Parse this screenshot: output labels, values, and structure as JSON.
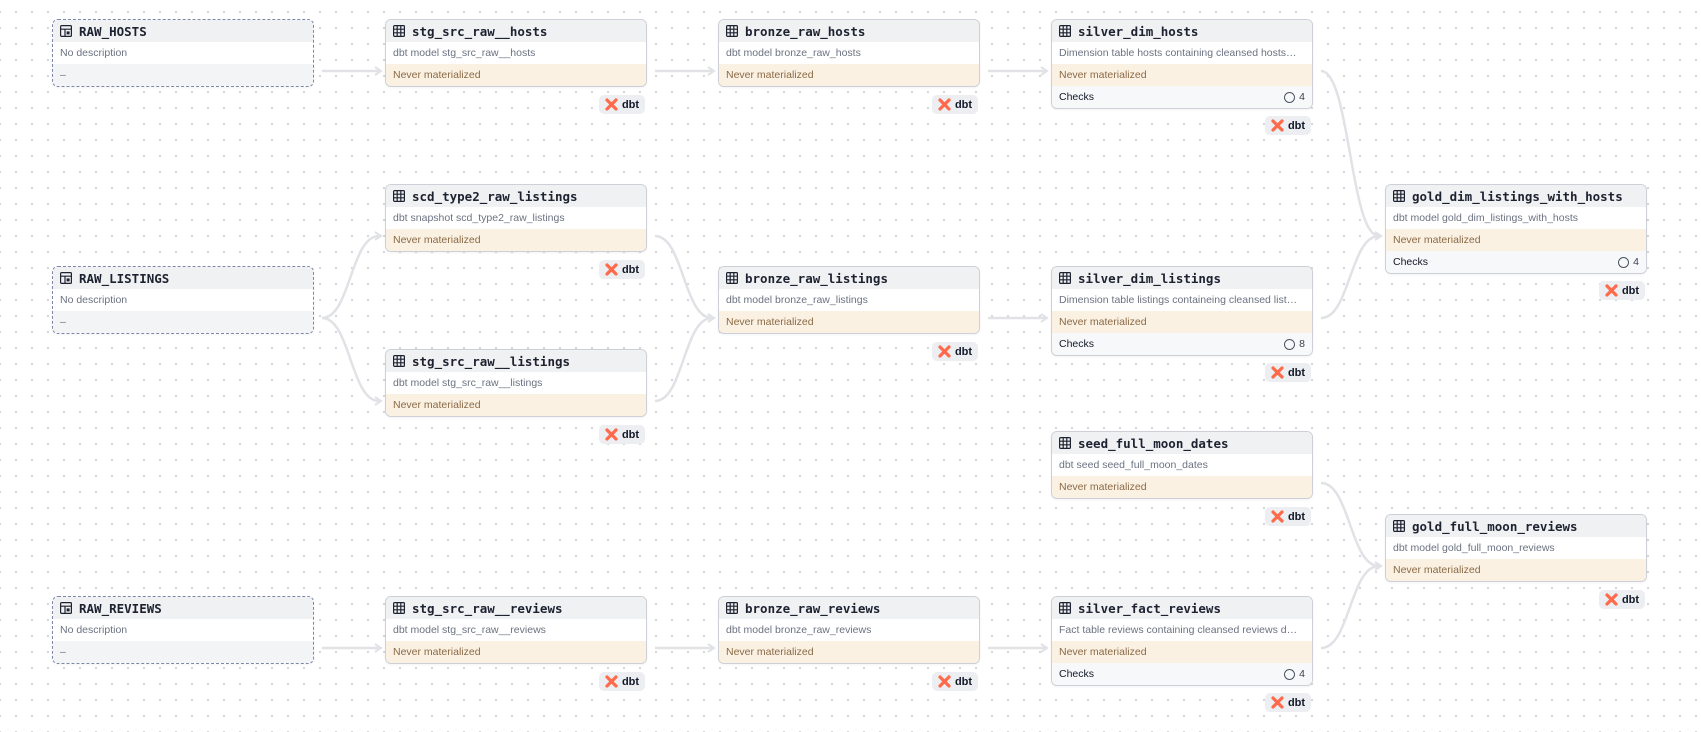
{
  "colors": {
    "edge": "#e1e2e6",
    "source_border": "#7d88a8",
    "materialized_bg": "#fbf1e3",
    "dbt_orange": "#fe6a4a"
  },
  "badge_label": "dbt",
  "nodes": {
    "raw_hosts": {
      "title": "RAW_HOSTS",
      "description": "No description",
      "footer": "–"
    },
    "raw_listings": {
      "title": "RAW_LISTINGS",
      "description": "No description",
      "footer": "–"
    },
    "raw_reviews": {
      "title": "RAW_REVIEWS",
      "description": "No description",
      "footer": "–"
    },
    "stg_src_raw__hosts": {
      "title": "stg_src_raw__hosts",
      "description": "dbt model stg_src_raw__hosts",
      "status": "Never materialized"
    },
    "scd_type2_raw_listings": {
      "title": "scd_type2_raw_listings",
      "description": "dbt snapshot scd_type2_raw_listings",
      "status": "Never materialized"
    },
    "stg_src_raw__listings": {
      "title": "stg_src_raw__listings",
      "description": "dbt model stg_src_raw__listings",
      "status": "Never materialized"
    },
    "stg_src_raw__reviews": {
      "title": "stg_src_raw__reviews",
      "description": "dbt model stg_src_raw__reviews",
      "status": "Never materialized"
    },
    "bronze_raw_hosts": {
      "title": "bronze_raw_hosts",
      "description": "dbt model bronze_raw_hosts",
      "status": "Never materialized"
    },
    "bronze_raw_listings": {
      "title": "bronze_raw_listings",
      "description": "dbt model bronze_raw_listings",
      "status": "Never materialized"
    },
    "bronze_raw_reviews": {
      "title": "bronze_raw_reviews",
      "description": "dbt model bronze_raw_reviews",
      "status": "Never materialized"
    },
    "silver_dim_hosts": {
      "title": "silver_dim_hosts",
      "description": "Dimension table hosts containing cleansed hosts…",
      "status": "Never materialized",
      "checks_label": "Checks",
      "checks_count": "4"
    },
    "silver_dim_listings": {
      "title": "silver_dim_listings",
      "description": "Dimension table listings containeing cleansed list…",
      "status": "Never materialized",
      "checks_label": "Checks",
      "checks_count": "8"
    },
    "seed_full_moon_dates": {
      "title": "seed_full_moon_dates",
      "description": "dbt seed seed_full_moon_dates",
      "status": "Never materialized"
    },
    "silver_fact_reviews": {
      "title": "silver_fact_reviews",
      "description": "Fact table reviews containing cleansed reviews d…",
      "status": "Never materialized",
      "checks_label": "Checks",
      "checks_count": "4"
    },
    "gold_dim_listings_with_hosts": {
      "title": "gold_dim_listings_with_hosts",
      "description": "dbt model gold_dim_listings_with_hosts",
      "status": "Never materialized",
      "checks_label": "Checks",
      "checks_count": "4"
    },
    "gold_full_moon_reviews": {
      "title": "gold_full_moon_reviews",
      "description": "dbt model gold_full_moon_reviews",
      "status": "Never materialized"
    }
  },
  "edges": [
    [
      "raw_hosts",
      "stg_src_raw__hosts"
    ],
    [
      "stg_src_raw__hosts",
      "bronze_raw_hosts"
    ],
    [
      "bronze_raw_hosts",
      "silver_dim_hosts"
    ],
    [
      "silver_dim_hosts",
      "gold_dim_listings_with_hosts"
    ],
    [
      "raw_listings",
      "scd_type2_raw_listings"
    ],
    [
      "raw_listings",
      "stg_src_raw__listings"
    ],
    [
      "scd_type2_raw_listings",
      "bronze_raw_listings"
    ],
    [
      "stg_src_raw__listings",
      "bronze_raw_listings"
    ],
    [
      "bronze_raw_listings",
      "silver_dim_listings"
    ],
    [
      "silver_dim_listings",
      "gold_dim_listings_with_hosts"
    ],
    [
      "raw_reviews",
      "stg_src_raw__reviews"
    ],
    [
      "stg_src_raw__reviews",
      "bronze_raw_reviews"
    ],
    [
      "bronze_raw_reviews",
      "silver_fact_reviews"
    ],
    [
      "seed_full_moon_dates",
      "gold_full_moon_reviews"
    ],
    [
      "silver_fact_reviews",
      "gold_full_moon_reviews"
    ]
  ]
}
